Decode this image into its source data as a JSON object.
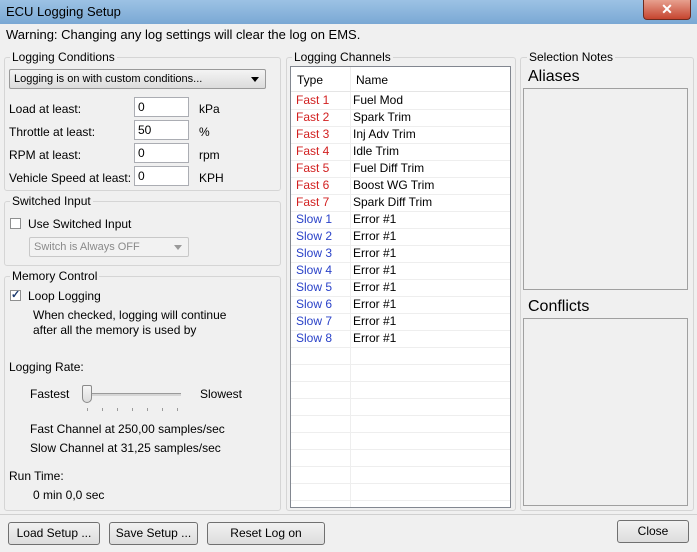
{
  "window": {
    "title": "ECU Logging Setup",
    "close_glyph": "✕"
  },
  "warning": "Warning: Changing any log settings will clear the log on EMS.",
  "logging_conditions": {
    "label": "Logging Conditions",
    "mode": "Logging is on with custom conditions...",
    "fields": [
      {
        "label": "Load at least:",
        "value": "0",
        "unit": "kPa"
      },
      {
        "label": "Throttle at least:",
        "value": "50",
        "unit": "%"
      },
      {
        "label": "RPM at least:",
        "value": "0",
        "unit": "rpm"
      },
      {
        "label": "Vehicle Speed at least:",
        "value": "0",
        "unit": "KPH"
      }
    ]
  },
  "switched_input": {
    "label": "Switched Input",
    "checkbox_label": "Use Switched Input",
    "checked": false,
    "select_value": "Switch is Always OFF"
  },
  "memory_control": {
    "label": "Memory Control",
    "loop_label": "Loop Logging",
    "loop_checked": true,
    "note_line1": "When checked, logging will continue",
    "note_line2": "after all the memory is used by",
    "rate_label": "Logging Rate:",
    "fastest": "Fastest",
    "slowest": "Slowest",
    "slider_level": 0,
    "fast_channel": "Fast Channel at 250,00 samples/sec",
    "slow_channel": "Slow Channel at 31,25 samples/sec",
    "run_time_label": "Run Time:",
    "run_time_value": "0 min 0,0 sec"
  },
  "logging_channels": {
    "label": "Logging Channels",
    "col_type": "Type",
    "col_name": "Name",
    "rows": [
      {
        "type": "Fast 1",
        "name": "Fuel Mod",
        "kind": "fast"
      },
      {
        "type": "Fast 2",
        "name": "Spark Trim",
        "kind": "fast"
      },
      {
        "type": "Fast 3",
        "name": "Inj Adv Trim",
        "kind": "fast"
      },
      {
        "type": "Fast 4",
        "name": "Idle Trim",
        "kind": "fast"
      },
      {
        "type": "Fast 5",
        "name": "Fuel Diff Trim",
        "kind": "fast"
      },
      {
        "type": "Fast 6",
        "name": "Boost WG Trim",
        "kind": "fast"
      },
      {
        "type": "Fast 7",
        "name": "Spark Diff Trim",
        "kind": "fast"
      },
      {
        "type": "Slow 1",
        "name": "Error #1",
        "kind": "slow"
      },
      {
        "type": "Slow 2",
        "name": "Error #1",
        "kind": "slow"
      },
      {
        "type": "Slow 3",
        "name": "Error #1",
        "kind": "slow"
      },
      {
        "type": "Slow 4",
        "name": "Error #1",
        "kind": "slow"
      },
      {
        "type": "Slow 5",
        "name": "Error #1",
        "kind": "slow"
      },
      {
        "type": "Slow 6",
        "name": "Error #1",
        "kind": "slow"
      },
      {
        "type": "Slow 7",
        "name": "Error #1",
        "kind": "slow"
      },
      {
        "type": "Slow 8",
        "name": "Error #1",
        "kind": "slow"
      }
    ]
  },
  "selection_notes": {
    "label": "Selection Notes",
    "aliases": "Aliases",
    "conflicts": "Conflicts"
  },
  "buttons": {
    "load": "Load Setup ...",
    "save": "Save Setup ...",
    "reset": "Reset Log on",
    "close": "Close"
  },
  "colors": {
    "fast": "#d22020",
    "slow": "#2a42c8"
  }
}
